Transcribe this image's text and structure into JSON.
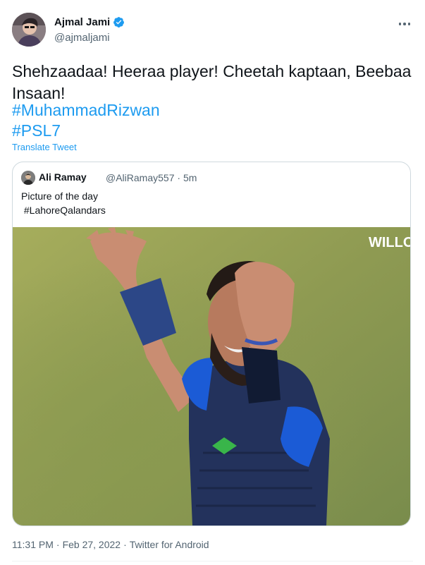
{
  "author": {
    "display_name": "Ajmal Jami",
    "handle": "@ajmaljami",
    "verified": true,
    "avatar_icon": "user-avatar"
  },
  "tweet": {
    "text": "Shehzaadaa! Heeraa player! Cheetah kaptaan, Beebaa Insaan!",
    "hashtags": [
      "#MuhammadRizwan",
      "#PSL7"
    ],
    "translate_label": "Translate Tweet"
  },
  "quote": {
    "display_name": "Ali Ramay",
    "handle": "@AliRamay557",
    "separator": "·",
    "age": "5m",
    "text_line1": "Picture of the day",
    "text_line2": " #LahoreQalandars",
    "image_watermark": "WILLO"
  },
  "footer": {
    "time": "11:31 PM",
    "dot1": "·",
    "date": "Feb 27, 2022",
    "dot2": "·",
    "source": "Twitter for Android"
  },
  "colors": {
    "link": "#1d9bf0",
    "text": "#0f1419",
    "secondary": "#536471",
    "border": "#cfd9de"
  }
}
